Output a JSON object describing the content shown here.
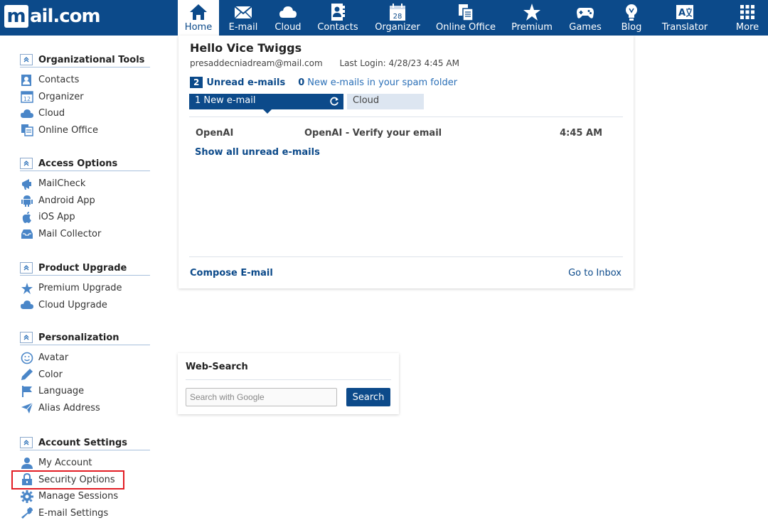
{
  "brand": {
    "logo_letter": "m",
    "logo_text": "ail.com"
  },
  "colors": {
    "brand_blue": "#0c4a8a",
    "link_blue": "#2a6fb7",
    "highlight_red": "#e21d24",
    "tab_bg": "#dde6f1"
  },
  "nav": {
    "items": [
      {
        "label": "Home",
        "icon": "home-icon",
        "active": true
      },
      {
        "label": "E-mail",
        "icon": "envelope-icon"
      },
      {
        "label": "Cloud",
        "icon": "cloud-icon"
      },
      {
        "label": "Contacts",
        "icon": "contacts-icon"
      },
      {
        "label": "Organizer",
        "icon": "calendar-icon",
        "icon_text": "28"
      },
      {
        "label": "Online Office",
        "icon": "office-icon"
      },
      {
        "label": "Premium",
        "icon": "star-icon"
      },
      {
        "label": "Games",
        "icon": "gamepad-icon"
      },
      {
        "label": "Blog",
        "icon": "lightbulb-icon"
      },
      {
        "label": "Translator",
        "icon": "translate-icon"
      },
      {
        "label": "More",
        "icon": "grid-icon"
      }
    ]
  },
  "sidebar": {
    "sections": [
      {
        "title": "Organizational Tools",
        "items": [
          {
            "label": "Contacts",
            "icon": "contacts-icon"
          },
          {
            "label": "Organizer",
            "icon": "calendar-icon",
            "icon_text": "12"
          },
          {
            "label": "Cloud",
            "icon": "cloud-icon"
          },
          {
            "label": "Online Office",
            "icon": "office-icon"
          }
        ]
      },
      {
        "title": "Access Options",
        "items": [
          {
            "label": "MailCheck",
            "icon": "megaphone-icon"
          },
          {
            "label": "Android App",
            "icon": "android-icon"
          },
          {
            "label": "iOS App",
            "icon": "apple-icon"
          },
          {
            "label": "Mail Collector",
            "icon": "inbox-tray-icon"
          }
        ]
      },
      {
        "title": "Product Upgrade",
        "items": [
          {
            "label": "Premium Upgrade",
            "icon": "star-icon"
          },
          {
            "label": "Cloud Upgrade",
            "icon": "cloud-icon"
          }
        ]
      },
      {
        "title": "Personalization",
        "items": [
          {
            "label": "Avatar",
            "icon": "smiley-icon"
          },
          {
            "label": "Color",
            "icon": "pencil-icon"
          },
          {
            "label": "Language",
            "icon": "flag-icon"
          },
          {
            "label": "Alias Address",
            "icon": "paper-plane-icon"
          }
        ]
      },
      {
        "title": "Account Settings",
        "items": [
          {
            "label": "My Account",
            "icon": "user-icon"
          },
          {
            "label": "Security Options",
            "icon": "lock-icon"
          },
          {
            "label": "Manage Sessions",
            "icon": "gear-icon"
          },
          {
            "label": "E-mail Settings",
            "icon": "wrench-icon"
          }
        ]
      }
    ]
  },
  "main": {
    "greeting": "Hello Vice Twiggs",
    "email": "presaddecniadream@mail.com",
    "last_login": "Last Login: 4/28/23 4:45 AM",
    "unread_count": "2",
    "unread_label": "Unread e-mails",
    "spam_count": "0",
    "spam_label": "New e-mails in your spam folder",
    "tab_new": "1 New e-mail",
    "tab_cloud": "Cloud",
    "messages": [
      {
        "from": "OpenAI",
        "subject": "OpenAI - Verify your email",
        "time": "4:45 AM"
      }
    ],
    "show_all": "Show all unread e-mails",
    "compose": "Compose E-mail",
    "go_inbox": "Go to Inbox"
  },
  "websearch": {
    "title": "Web-Search",
    "placeholder": "Search with Google",
    "value": "",
    "button": "Search"
  }
}
